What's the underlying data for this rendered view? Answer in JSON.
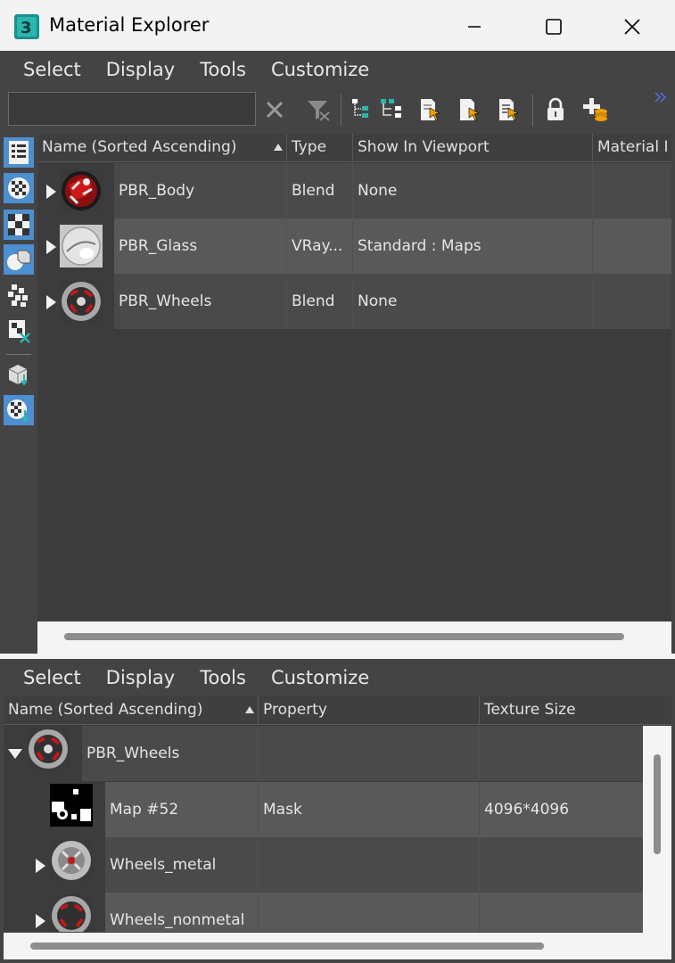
{
  "window": {
    "title": "Material Explorer",
    "controls": [
      "minimize-icon",
      "maximize-icon",
      "close-icon"
    ]
  },
  "top_menu": [
    "Select",
    "Display",
    "Tools",
    "Customize"
  ],
  "search": {
    "value": "",
    "placeholder": ""
  },
  "toolbar_icons": [
    "clear-search-icon",
    "filter-icon",
    "select-children-icon",
    "select-dependents-icon",
    "select-material-icon",
    "select-object-icon",
    "edit-selected-icon",
    "lock-icon",
    "add-layer-icon",
    "overflow-icon"
  ],
  "sidebar_icons": [
    "display-all-icon",
    "display-materials-icon",
    "display-maps-icon",
    "display-objects-icon",
    "display-unused-maps-icon",
    "display-incompatible-icon",
    "display-by-object-icon",
    "display-by-material-icon"
  ],
  "top_grid": {
    "columns": [
      "Name (Sorted Ascending)",
      "Type",
      "Show In Viewport",
      "Material I"
    ],
    "rows": [
      {
        "name": "PBR_Body",
        "type": "Blend",
        "show_in_viewport": "None",
        "material_id": ""
      },
      {
        "name": "PBR_Glass",
        "type": "VRay...",
        "show_in_viewport": "Standard : Maps",
        "material_id": ""
      },
      {
        "name": "PBR_Wheels",
        "type": "Blend",
        "show_in_viewport": "None",
        "material_id": ""
      }
    ]
  },
  "bottom_menu": [
    "Select",
    "Display",
    "Tools",
    "Customize"
  ],
  "bottom_grid": {
    "columns": [
      "Name (Sorted Ascending)",
      "Property",
      "Texture Size"
    ],
    "rows": [
      {
        "name": "PBR_Wheels",
        "property": "",
        "texture_size": ""
      },
      {
        "name": "Map #52",
        "property": "Mask",
        "texture_size": "4096*4096"
      },
      {
        "name": "Wheels_metal",
        "property": "",
        "texture_size": ""
      },
      {
        "name": "Wheels_nonmetal",
        "property": "",
        "texture_size": ""
      }
    ]
  },
  "colors": {
    "panel": "#444444",
    "grid": "#3c3c3c",
    "row_alt": "#595959",
    "highlight": "#4d8fd0",
    "titlebar": "#f3f3f3"
  }
}
